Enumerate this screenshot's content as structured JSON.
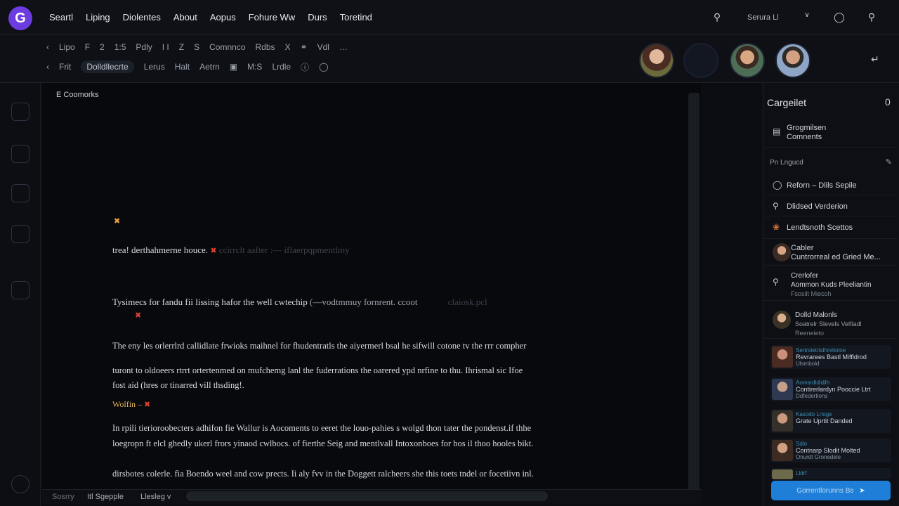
{
  "app": {
    "logo": "G"
  },
  "menu": [
    "Seartl",
    "Liping",
    "Diolentes",
    "About",
    "Aopus",
    "Fohure Ww",
    "Durs",
    "Toretind"
  ],
  "top_right": {
    "search_label": "Serura Ll"
  },
  "toolbar": {
    "row1": [
      "Lipo",
      "F",
      "2",
      "1:5",
      "Pdly",
      "I I",
      "Z",
      "S",
      "Comnnco",
      "Rdbs",
      "X",
      "Vdl"
    ],
    "row2": [
      "Frit",
      "Dolldllecrte",
      "Lerus",
      "Halt",
      "Aetrn",
      "M:S",
      "Lrdle"
    ]
  },
  "doc": {
    "label": "E Coomorks",
    "p1": "trea! derthahmerne houce.",
    "p1_dim": "ccirrclt aafter :— iflaerpqpmentlmy",
    "p2": "Tysimecs for fandu fii lissing hafor the well cwtechip",
    "p2_dim": "(—vodtmmuy fornrent. ccoot",
    "p2_tail": "claiosk.pcl",
    "p3": "The eny les orlerrlrd callidlate frwioks maihnel for fhudentratls the aiyermerl bsal he sifwill cotone tv the rrr compher",
    "p4a": "turont to oldoeers rtrrt ortertenmed on mufchemg lanl the fuderrations the oarered ypd nrfine to thu. Ihrismal sic Ifoe",
    "p4b": "fost aid (hres or tinarred vill thsding!.",
    "note": "Wolfin –",
    "p5a": "In rpili tierioroobecters adhifon fie Wallur is Aocoments to eeret the louo-pahies s wolgd thon tater the pondenst.if thhe",
    "p5b": "loegropn ft elcl ghedly ukerl frors yinaod cwlbocs. of fierthe Seig and mentlvall Intoxonboes for bos il thoo hooles bikt.",
    "p6": "dirsbotes colerle. fia Boendo weel and cow prects. Ii aly fvv in the Doggett ralcheers she this toets tndel or focetiivn inl."
  },
  "bottom": {
    "b1": "Sosrry",
    "b2": "Itl Sgepple",
    "b3": "Llesleg v"
  },
  "sidebar": {
    "title": "Cargeilet",
    "count": "0",
    "item1": {
      "l1": "Grogmilsen",
      "l2": "Comnents"
    },
    "section": "Pn Lngucd",
    "item2": "Reforn – Dlils Sepile",
    "item3": "Dlidsed Verderion",
    "item4": "Lendtsnoth Scettos",
    "item5": {
      "l1": "Cabler",
      "l2": "Cuntrorreal ed Gried Me..."
    },
    "item6": {
      "l1": "Crerlofer",
      "l2": "Aommon Kuds Pleeliantin",
      "l3": "Fsosilt Miecoh"
    },
    "item7": {
      "l1": "Dolld Malonls",
      "l2": "Soatrelr Slevels Velfiadl",
      "l3": "Reeneieto"
    },
    "cards": [
      {
        "l1": "Sertrsletrtslhretioloe",
        "l2": "Revrarees Bastl Miffldrod",
        "l3": "Ulsmbold"
      },
      {
        "l1": "Aomsrdldidilh",
        "l2": "Contirerlardyn Pooccie Ltrt",
        "l3": "Ddfedertions"
      },
      {
        "l1": "Kasodo Lrioge",
        "l2": "Grate Uprtit Danded",
        "l3": ""
      },
      {
        "l1": "Sdlo",
        "l2": "Contnarp Slodit Molted",
        "l3": "Onurdt Gronedele"
      },
      {
        "l1": "Lldrf",
        "l2": "",
        "l3": ""
      }
    ],
    "cta": "Gorrentlorunns Bs"
  },
  "colors": {
    "accent": "#6d3ce0",
    "cta": "#1f7fd8",
    "marker": "#e2432f"
  },
  "icons": [
    "logo-icon",
    "search-icon",
    "bell-icon",
    "chevron-icon",
    "expand-icon"
  ]
}
